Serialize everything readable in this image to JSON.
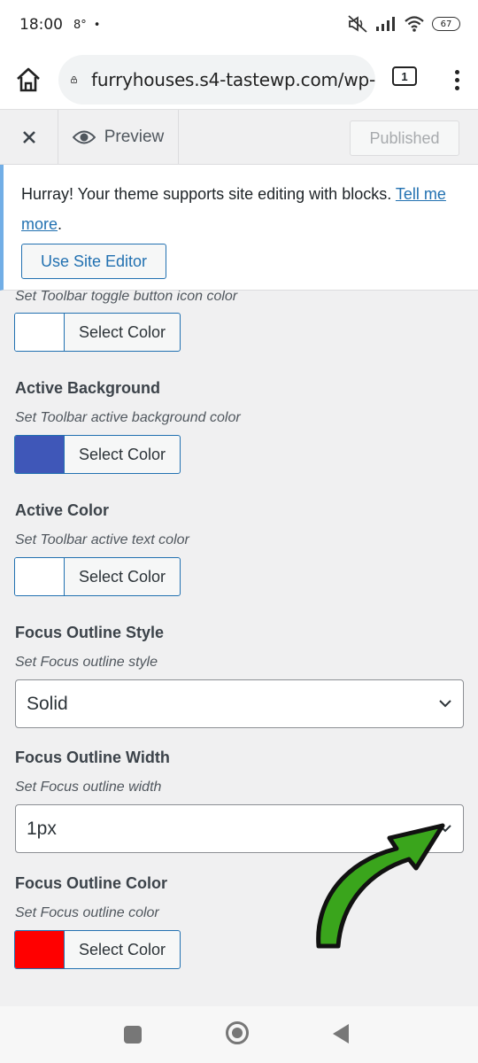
{
  "status_bar": {
    "time": "18:00",
    "temperature": "8°",
    "dot": "•",
    "battery": "67"
  },
  "browser": {
    "url": "furryhouses.s4-tastewp.com/wp-",
    "tab_count": "1"
  },
  "customizer_header": {
    "close_label": "×",
    "preview_label": "Preview",
    "published_label": "Published"
  },
  "notice": {
    "text": "Hurray! Your theme supports site editing with blocks. ",
    "link_text": "Tell me more",
    "trailing": ".",
    "button_label": "Use Site Editor"
  },
  "controls": {
    "toggle_icon": {
      "description": "Set Toolbar toggle button icon color",
      "button_label": "Select Color",
      "color": "#ffffff"
    },
    "active_background": {
      "title": "Active Background",
      "description": "Set Toolbar active background color",
      "button_label": "Select Color",
      "color": "#3f57b8"
    },
    "active_color": {
      "title": "Active Color",
      "description": "Set Toolbar active text color",
      "button_label": "Select Color",
      "color": "#ffffff"
    },
    "focus_outline_style": {
      "title": "Focus Outline Style",
      "description": "Set Focus outline style",
      "value": "Solid"
    },
    "focus_outline_width": {
      "title": "Focus Outline Width",
      "description": "Set Focus outline width",
      "value": "1px"
    },
    "focus_outline_color": {
      "title": "Focus Outline Color",
      "description": "Set Focus outline color",
      "button_label": "Select Color",
      "color": "#ff0000"
    }
  },
  "colors": {
    "wp_blue": "#2271b1",
    "arrow_green": "#3aa51c"
  }
}
